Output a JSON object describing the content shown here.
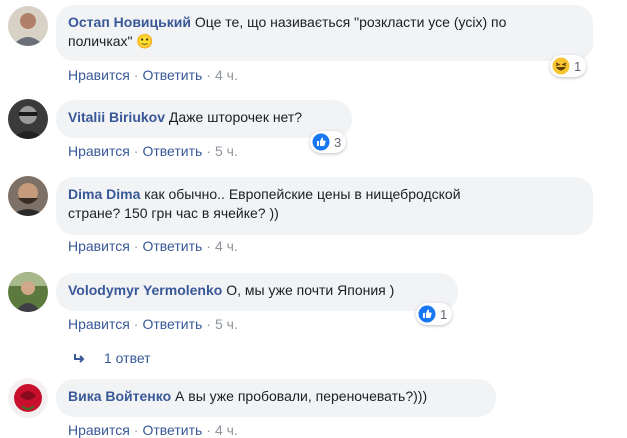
{
  "comments": [
    {
      "author": "Остап Новицький",
      "text": " Оце те, що називається \"розкласти усе (усіх) по",
      "text2": "поличках\"",
      "emoji": "🙂",
      "actions": {
        "like": "Нравится",
        "reply": "Ответить",
        "time": "4 ч."
      },
      "reaction": {
        "icon": "haha-icon",
        "count": "1"
      }
    },
    {
      "author": "Vitalii Biriukov",
      "text": " Даже шторочек нет?",
      "actions": {
        "like": "Нравится",
        "reply": "Ответить",
        "time": "5 ч."
      },
      "reaction": {
        "icon": "like-icon",
        "count": "3"
      }
    },
    {
      "author": "Dima Dima",
      "text": " как обычно.. Европейские цены в нищебродской",
      "text2": "стране? 150 грн час в ячейке? ))",
      "actions": {
        "like": "Нравится",
        "reply": "Ответить",
        "time": "4 ч."
      }
    },
    {
      "author": "Volodymyr Yermolenko",
      "text": " О, мы уже почти Япония )",
      "actions": {
        "like": "Нравится",
        "reply": "Ответить",
        "time": "5 ч."
      },
      "reaction": {
        "icon": "like-icon",
        "count": "1"
      }
    },
    {
      "author": "Вика Войтенко",
      "text": " А вы уже пробовали, переночевать?)))",
      "actions": {
        "like": "Нравится",
        "reply": "Ответить",
        "time": "4 ч."
      }
    }
  ],
  "replies": {
    "label": "1 ответ"
  },
  "colors": {
    "link": "#385898",
    "bubble": "#f2f3f5",
    "meta": "#90949c",
    "like_blue": "#1877f2"
  }
}
